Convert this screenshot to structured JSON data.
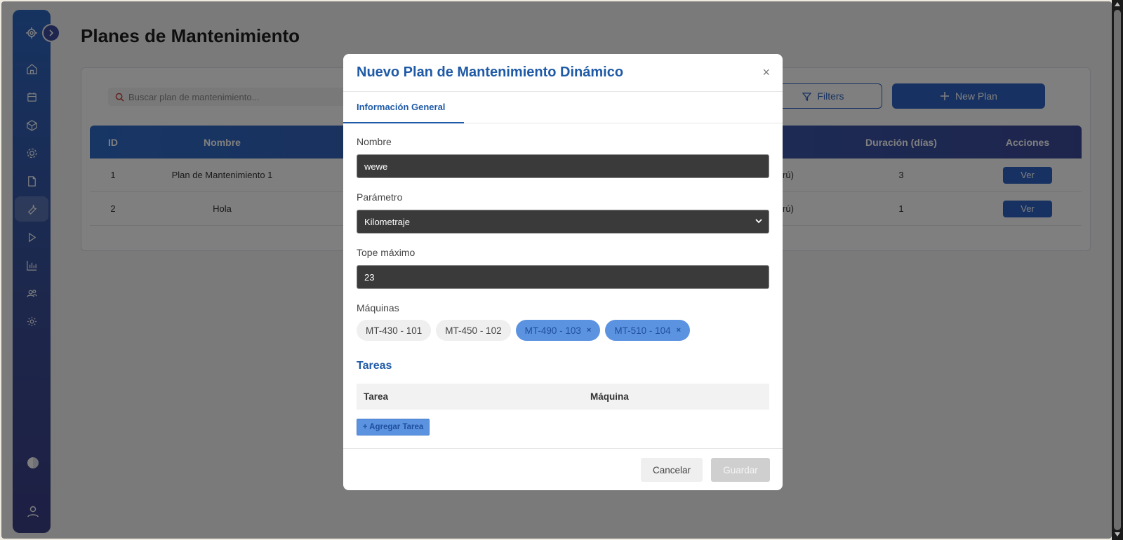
{
  "page": {
    "title": "Planes de Mantenimiento"
  },
  "toolbar": {
    "search_placeholder": "Buscar plan de mantenimiento...",
    "filters_label": "Filters",
    "new_plan_label": "New Plan"
  },
  "table": {
    "headers": {
      "id": "ID",
      "nombre": "Nombre",
      "duracion": "Duración (días)",
      "acciones": "Acciones"
    },
    "rows": [
      {
        "id": "1",
        "nombre": "Plan de Mantenimiento 1",
        "partial": "rú)",
        "duracion": "3",
        "action": "Ver"
      },
      {
        "id": "2",
        "nombre": "Hola",
        "partial": "rú)",
        "duracion": "1",
        "action": "Ver"
      }
    ]
  },
  "sidebar": {
    "icons": [
      "logo-icon",
      "home-icon",
      "calendar-icon",
      "box-icon",
      "settings-icon",
      "file-icon",
      "wrench-icon",
      "play-icon",
      "chart-icon",
      "users-icon",
      "gear-icon"
    ],
    "active": "wrench-icon"
  },
  "modal": {
    "title": "Nuevo Plan de Mantenimiento Dinámico",
    "close": "×",
    "tab": "Información General",
    "nombre_label": "Nombre",
    "nombre_value": "wewe",
    "parametro_label": "Parámetro",
    "parametro_value": "Kilometraje",
    "tope_label": "Tope máximo",
    "tope_value": "23",
    "maquinas_label": "Máquinas",
    "maquinas": [
      {
        "label": "MT-430 - 101",
        "selected": false
      },
      {
        "label": "MT-450 - 102",
        "selected": false
      },
      {
        "label": "MT-490 - 103",
        "selected": true,
        "remove": "×"
      },
      {
        "label": "MT-510 - 104",
        "selected": true,
        "remove": "×"
      }
    ],
    "tareas_title": "Tareas",
    "tareas_headers": {
      "tarea": "Tarea",
      "maquina": "Máquina"
    },
    "add_task": "+ Agregar Tarea",
    "cancel": "Cancelar",
    "save": "Guardar"
  },
  "colors": {
    "primary": "#2f64c5",
    "modal_accent": "#1f5aa6",
    "chip_selected": "#5b93e0",
    "field_dark": "#3a3a3a"
  }
}
